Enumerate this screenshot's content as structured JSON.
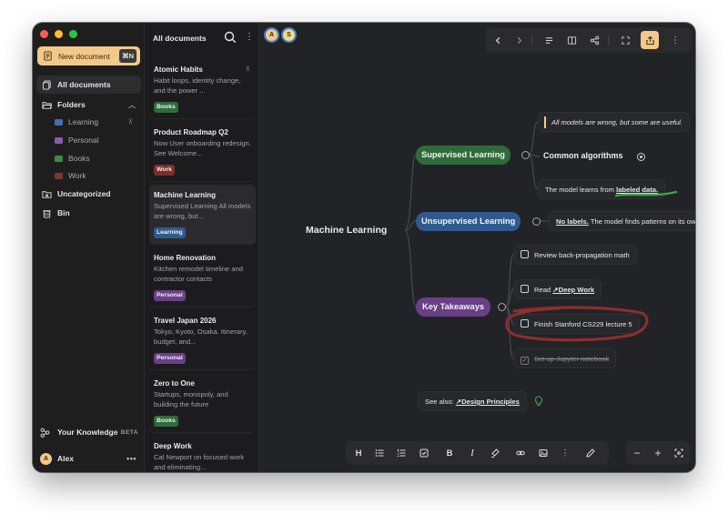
{
  "sidebar": {
    "new_document_label": "New document",
    "new_document_shortcut": "⌘N",
    "all_documents": "All documents",
    "folders_label": "Folders",
    "folders": [
      {
        "name": "Learning",
        "color": "#3f6fb5"
      },
      {
        "name": "Personal",
        "color": "#8a5aa8"
      },
      {
        "name": "Books",
        "color": "#3b8a4a"
      },
      {
        "name": "Work",
        "color": "#7a3a34"
      }
    ],
    "uncategorized": "Uncategorized",
    "bin": "Bin",
    "your_knowledge": "Your Knowledge",
    "beta_badge": "BETA",
    "user_initial": "A",
    "user_name": "Alex"
  },
  "doclist": {
    "title": "All documents",
    "docs": [
      {
        "title": "Atomic Habits",
        "preview": "Habit loops, identity change, and the power ...",
        "tag": "Books",
        "tag_color": "#2f6b3a"
      },
      {
        "title": "Product Roadmap Q2",
        "preview": "Now User onboarding redesign. See Welcome...",
        "tag": "Work",
        "tag_color": "#7a2f2a"
      },
      {
        "title": "Machine Learning",
        "preview": "Supervised Learning All models are wrong, but...",
        "tag": "Learning",
        "tag_color": "#2f5a8f"
      },
      {
        "title": "Home Renovation",
        "preview": "Kitchen remodel timeline and contractor contacts",
        "tag": "Personal",
        "tag_color": "#6a3f86"
      },
      {
        "title": "Travel Japan 2026",
        "preview": "Tokyo, Kyoto, Osaka. Itinerary, budget, and...",
        "tag": "Personal",
        "tag_color": "#6a3f86"
      },
      {
        "title": "Zero to One",
        "preview": "Startups, monopoly, and building the future",
        "tag": "Books",
        "tag_color": "#2f6b3a"
      },
      {
        "title": "Deep Work",
        "preview": "Cal Newport on focused work and eliminating...",
        "tag": "",
        "tag_color": "#2f6b3a"
      }
    ]
  },
  "collaborators": [
    {
      "initial": "A",
      "color": "#f2c98a"
    },
    {
      "initial": "S",
      "color": "#f0dc8a"
    }
  ],
  "mindmap": {
    "root": "Machine Learning",
    "branches": [
      {
        "label": "Supervised Learning",
        "color": "#2f6b3a"
      },
      {
        "label": "Unsupervised Learning",
        "color": "#2f5a8f"
      },
      {
        "label": "Key Takeaways",
        "color": "#6a3f86"
      }
    ],
    "quote": "All models are wrong, but some are useful.",
    "common_algorithms": "Common algorithms",
    "labeled_text": "The model learns from ",
    "labeled_highlight": "labeled data.",
    "unlabeled_bold": "No labels.",
    "unlabeled_text": " The model finds patterns on its own.",
    "tasks": [
      {
        "text": "Review back-propagation math",
        "done": false
      },
      {
        "prefix": "Read ",
        "link": "↗Deep Work",
        "done": false
      },
      {
        "text": "Finish Stanford CS229 lecture 5",
        "done": false
      },
      {
        "text": "Set up Jupyter notebook",
        "done": true
      }
    ],
    "see_also_prefix": "See also: ",
    "see_also_link": "↗Design Principles"
  },
  "toolbar": {
    "heading": "H",
    "bold": "B",
    "italic": "I"
  },
  "zoom": {
    "minus": "−",
    "plus": "+"
  }
}
